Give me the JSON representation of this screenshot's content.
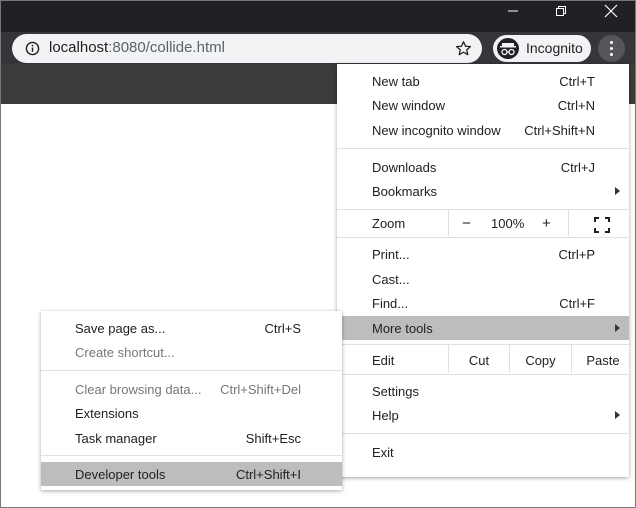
{
  "window": {
    "controls": [
      "minimize-icon",
      "restore-icon",
      "close-icon"
    ]
  },
  "address_bar": {
    "host": "localhost",
    "path": ":8080/collide.html",
    "icons": [
      "info-icon",
      "star-icon"
    ]
  },
  "incognito": {
    "label": "Incognito",
    "icon": "incognito-spy-icon"
  },
  "menu_button": {
    "icon": "three-dots-vertical-icon"
  },
  "main_menu": {
    "new_tab": {
      "label": "New tab",
      "shortcut": "Ctrl+T"
    },
    "new_window": {
      "label": "New window",
      "shortcut": "Ctrl+N"
    },
    "new_incognito": {
      "label": "New incognito window",
      "shortcut": "Ctrl+Shift+N"
    },
    "downloads": {
      "label": "Downloads",
      "shortcut": "Ctrl+J"
    },
    "bookmarks": {
      "label": "Bookmarks"
    },
    "zoom": {
      "label": "Zoom",
      "minus": "−",
      "level": "100%",
      "plus": "+",
      "fullscreen_icon": "fullscreen-icon"
    },
    "print": {
      "label": "Print...",
      "shortcut": "Ctrl+P"
    },
    "cast": {
      "label": "Cast..."
    },
    "find": {
      "label": "Find...",
      "shortcut": "Ctrl+F"
    },
    "more_tools": {
      "label": "More tools"
    },
    "edit": {
      "label": "Edit",
      "cut": "Cut",
      "copy": "Copy",
      "paste": "Paste"
    },
    "settings": {
      "label": "Settings"
    },
    "help": {
      "label": "Help"
    },
    "exit": {
      "label": "Exit"
    }
  },
  "more_tools_menu": {
    "save_page": {
      "label": "Save page as...",
      "shortcut": "Ctrl+S"
    },
    "create_shortcut": {
      "label": "Create shortcut..."
    },
    "clear_browsing": {
      "label": "Clear browsing data...",
      "shortcut": "Ctrl+Shift+Del"
    },
    "extensions": {
      "label": "Extensions"
    },
    "task_manager": {
      "label": "Task manager",
      "shortcut": "Shift+Esc"
    },
    "developer_tools": {
      "label": "Developer tools",
      "shortcut": "Ctrl+Shift+I"
    }
  },
  "colors": {
    "highlight": "#bdbdbd",
    "toolbar": "#35363a",
    "titlebar": "#202124"
  }
}
